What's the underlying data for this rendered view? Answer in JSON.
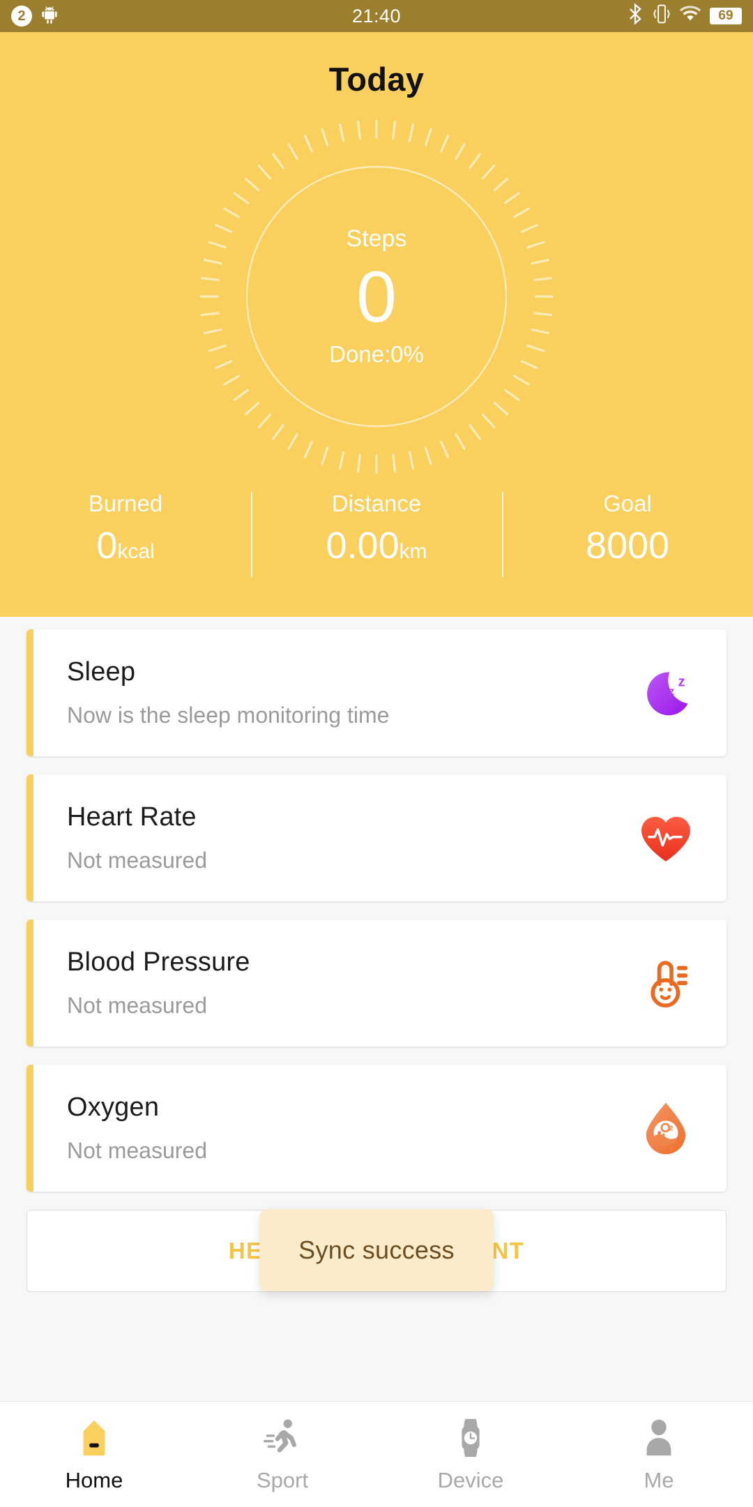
{
  "statusbar": {
    "notif_count": "2",
    "android_icon": "android-robot-icon",
    "time": "21:40",
    "bluetooth_icon": "bluetooth-icon",
    "vibrate_icon": "vibrate-icon",
    "wifi_icon": "wifi-icon",
    "battery_level": "69"
  },
  "header": {
    "title": "Today",
    "dial": {
      "label": "Steps",
      "value": "0",
      "sub": "Done:0%",
      "progress_percent": 0
    },
    "stats": [
      {
        "name": "Burned",
        "value": "0",
        "unit": "kcal"
      },
      {
        "name": "Distance",
        "value": "0.00",
        "unit": "km"
      },
      {
        "name": "Goal",
        "value": "8000",
        "unit": ""
      }
    ]
  },
  "cards": [
    {
      "title": "Sleep",
      "subtitle": "Now is the sleep monitoring time",
      "icon": "sleep-moon-icon"
    },
    {
      "title": "Heart Rate",
      "subtitle": "Not measured",
      "icon": "heart-rate-icon"
    },
    {
      "title": "Blood Pressure",
      "subtitle": "Not measured",
      "icon": "blood-pressure-icon"
    },
    {
      "title": "Oxygen",
      "subtitle": "Not measured",
      "icon": "blood-oxygen-icon"
    }
  ],
  "measure_button": {
    "label": "HEALTH MEASUREMENT"
  },
  "toast": {
    "message": "Sync success"
  },
  "bottomnav": {
    "items": [
      {
        "label": "Home",
        "icon": "home-icon",
        "active": true
      },
      {
        "label": "Sport",
        "icon": "runner-icon",
        "active": false
      },
      {
        "label": "Device",
        "icon": "watch-icon",
        "active": false
      },
      {
        "label": "Me",
        "icon": "person-icon",
        "active": false
      }
    ]
  },
  "colors": {
    "header_yellow": "#f9cf5d",
    "statusbar": "#9c7f2e",
    "accent_bar": "#f8cf5e",
    "button_text": "#f5c445",
    "toast_bg": "#faeccb",
    "toast_text": "#6b4d20",
    "sleep_purple": "#a93ef2",
    "heart_red": "#f4402e",
    "bp_orange": "#ea6a1f",
    "oxygen_orange": "#f0854a",
    "page_bg": "#f7f7f7"
  }
}
